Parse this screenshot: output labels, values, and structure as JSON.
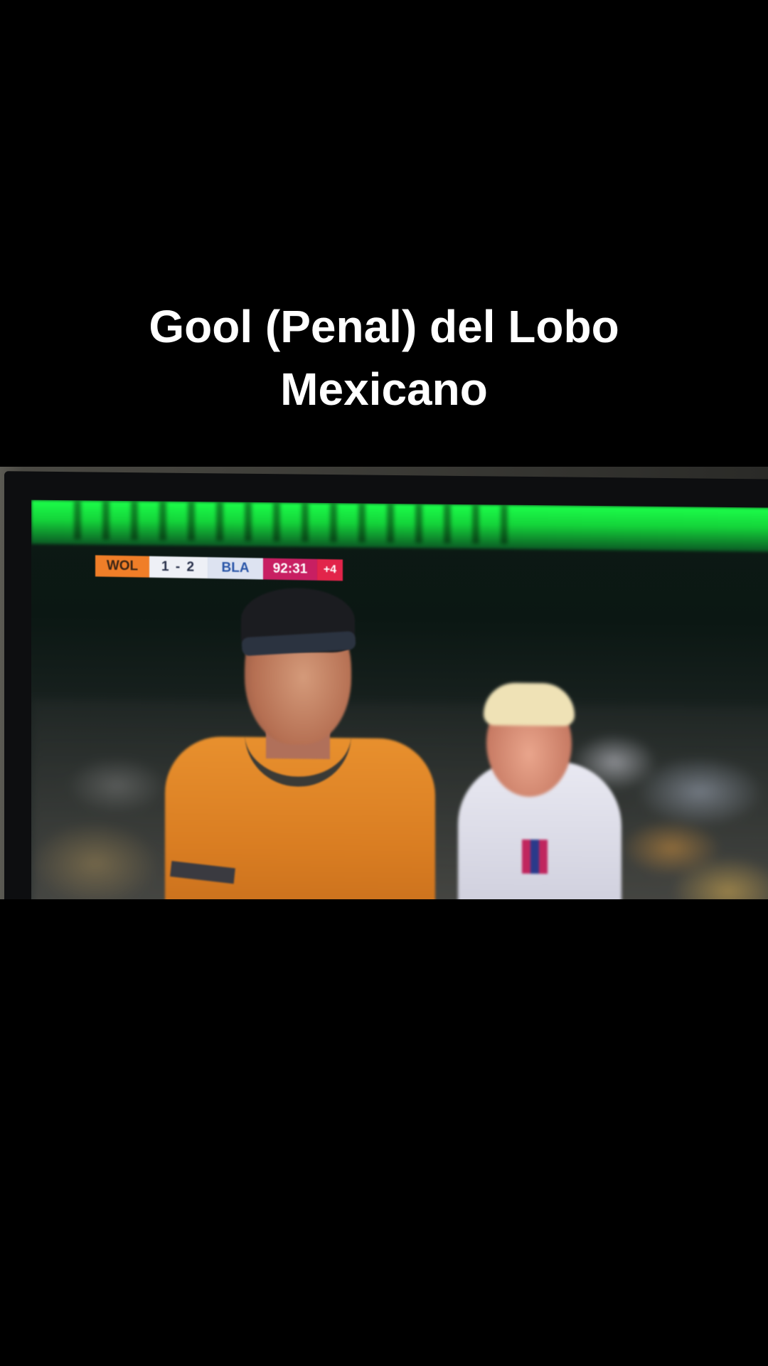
{
  "caption": {
    "line1": "Gool (Penal) del Lobo",
    "line2": "Mexicano"
  },
  "scoreboard": {
    "home_team": "WOL",
    "score": "1 - 2",
    "away_team": "BLA",
    "clock": "92:31",
    "added_time": "+4"
  },
  "colors": {
    "home": "#f07e28",
    "away": "#dde3f1",
    "clock": "#c81f62",
    "added": "#e2244a",
    "banner": "#1cff4a"
  }
}
